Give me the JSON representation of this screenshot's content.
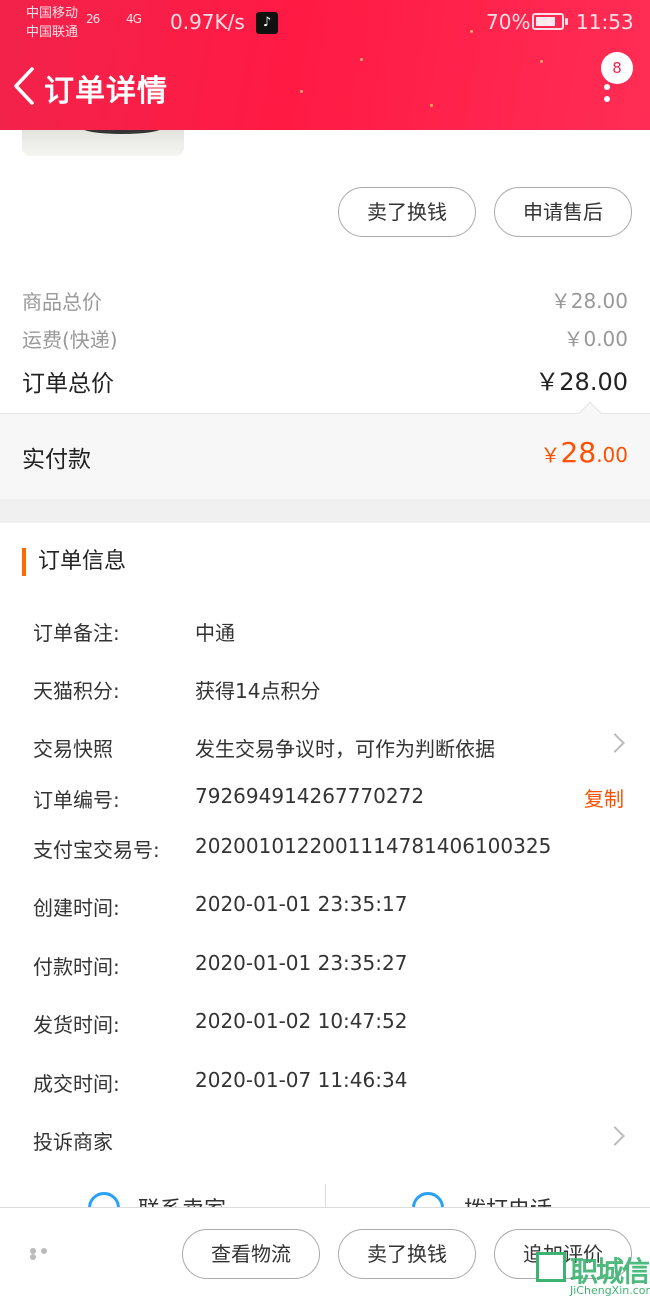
{
  "status_bar": {
    "carrier1": "中国移动",
    "carrier2": "中国联通",
    "signal1": "26",
    "signal2": "4G",
    "net_speed": "0.97K/s",
    "battery_pct": "70%",
    "time": "11:53"
  },
  "header": {
    "title": "订单详情",
    "badge_count": "8",
    "bg_color": "#ff1a44"
  },
  "item_actions": {
    "sell_label": "卖了换钱",
    "after_sale_label": "申请售后"
  },
  "price": {
    "goods_total_label": "商品总价",
    "goods_total_value": "￥28.00",
    "shipping_label": "运费(快递)",
    "shipping_value": "￥0.00",
    "order_total_label": "订单总价",
    "order_total_value": "￥28.00",
    "paid_label": "实付款",
    "paid_currency": "￥",
    "paid_int": "28",
    "paid_dec": ".00",
    "accent_color": "#ff5000"
  },
  "order_info": {
    "title": "订单信息",
    "rows": [
      {
        "label": "订单备注:",
        "value": "中通"
      },
      {
        "label": "天猫积分:",
        "value": "获得14点积分"
      },
      {
        "label": "交易快照",
        "value": "发生交易争议时，可作为判断依据"
      },
      {
        "label": "订单编号:",
        "value": "792694914267770272"
      },
      {
        "label": "支付宝交易号:",
        "value": "2020010122001114781406100325"
      },
      {
        "label": "创建时间:",
        "value": "2020-01-01 23:35:17"
      },
      {
        "label": "付款时间:",
        "value": "2020-01-01 23:35:27"
      },
      {
        "label": "发货时间:",
        "value": "2020-01-02 10:47:52"
      },
      {
        "label": "成交时间:",
        "value": "2020-01-07 11:46:34"
      }
    ],
    "copy_label": "复制",
    "complain_label": "投诉商家"
  },
  "contact": {
    "seller_label": "联系卖家",
    "call_label": "拨打电话"
  },
  "bottom_bar": {
    "logistics_label": "查看物流",
    "sell_label": "卖了换钱",
    "review_label": "追加评价"
  },
  "watermark": {
    "cn": "职城信",
    "en": "JiChengXin.com"
  }
}
